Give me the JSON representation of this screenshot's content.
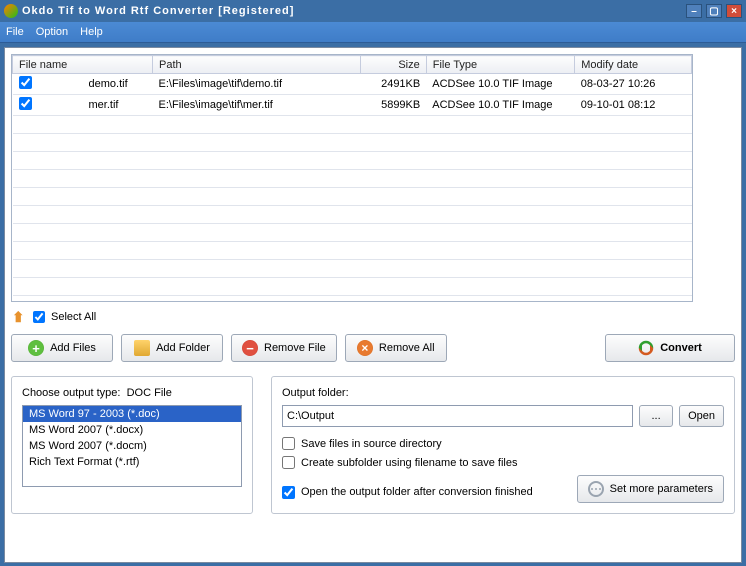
{
  "titlebar": {
    "text": "Okdo Tif to Word Rtf Converter [Registered]"
  },
  "menu": {
    "file": "File",
    "option": "Option",
    "help": "Help"
  },
  "columns": {
    "name": "File name",
    "path": "Path",
    "size": "Size",
    "type": "File Type",
    "date": "Modify date"
  },
  "files": [
    {
      "checked": true,
      "name": "demo.tif",
      "path": "E:\\Files\\image\\tif\\demo.tif",
      "size": "2491KB",
      "type": "ACDSee 10.0 TIF Image",
      "date": "08-03-27 10:26"
    },
    {
      "checked": true,
      "name": "mer.tif",
      "path": "E:\\Files\\image\\tif\\mer.tif",
      "size": "5899KB",
      "type": "ACDSee 10.0 TIF Image",
      "date": "09-10-01 08:12"
    }
  ],
  "selectall": {
    "label": "Select All",
    "checked": true
  },
  "buttons": {
    "add_files": "Add Files",
    "add_folder": "Add Folder",
    "remove_file": "Remove File",
    "remove_all": "Remove All",
    "convert": "Convert"
  },
  "output_type": {
    "label_prefix": "Choose output type:",
    "current": "DOC File",
    "options": [
      "MS Word 97 - 2003 (*.doc)",
      "MS Word 2007 (*.docx)",
      "MS Word 2007 (*.docm)",
      "Rich Text Format (*.rtf)"
    ],
    "selected_index": 0
  },
  "output_folder": {
    "label": "Output folder:",
    "path": "C:\\Output",
    "browse": "...",
    "open": "Open"
  },
  "options": {
    "save_source": {
      "label": "Save files in source directory",
      "checked": false
    },
    "subfolder": {
      "label": "Create subfolder using filename to save files",
      "checked": false
    },
    "open_after": {
      "label": "Open the output folder after conversion finished",
      "checked": true
    }
  },
  "more_params": "Set more parameters"
}
